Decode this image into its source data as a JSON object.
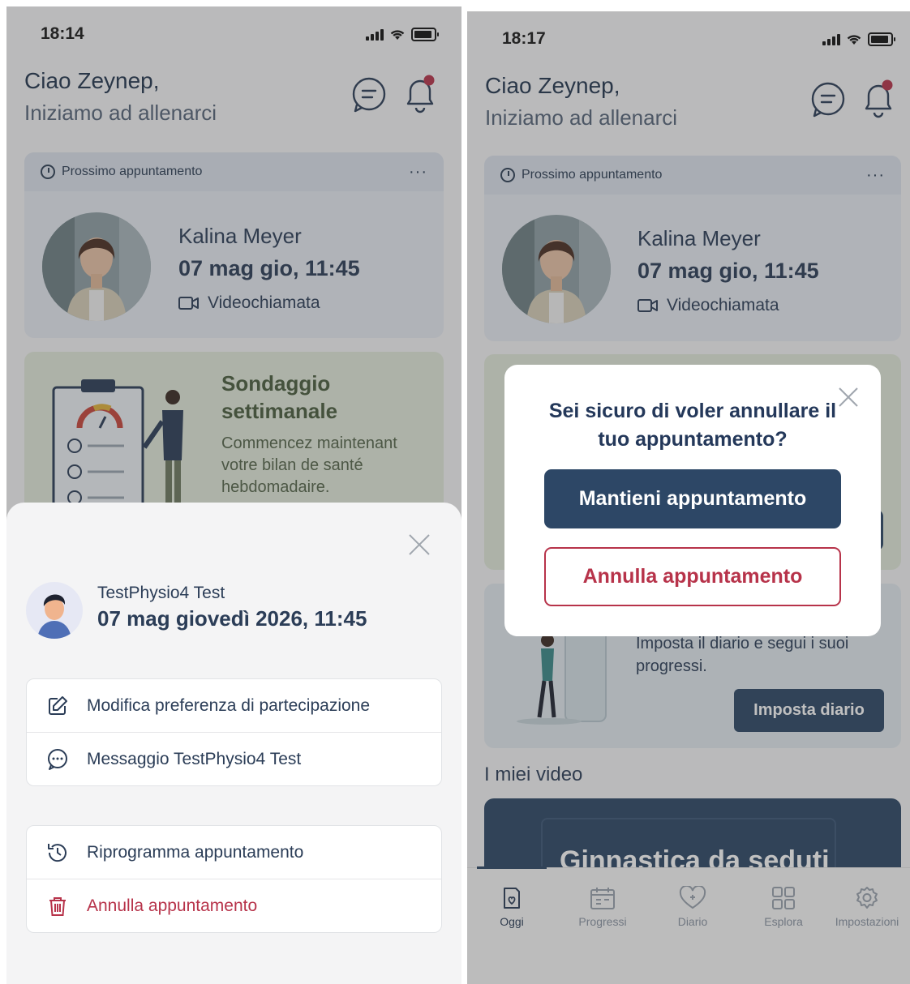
{
  "left": {
    "status_time": "18:14",
    "greeting": "Ciao Zeynep,",
    "subgreeting": "Iniziamo ad allenarci",
    "next_appointment": {
      "header": "Prossimo appuntamento",
      "more": "···",
      "name": "Kalina Meyer",
      "date": "07 mag gio, 11:45",
      "type": "Videochiamata"
    },
    "survey": {
      "title_line1": "Sondaggio",
      "title_line2": "settimanale",
      "desc_line1": "Commencez maintenant",
      "desc_line2": "votre bilan de santé",
      "desc_line3": "hebdomadaire."
    },
    "sheet": {
      "therapist": "TestPhysio4 Test",
      "datetime": "07 mag giovedì 2026, 11:45",
      "actions_group1": [
        {
          "label": "Modifica preferenza di partecipazione",
          "icon": "edit-icon"
        },
        {
          "label": "Messaggio TestPhysio4 Test",
          "icon": "chat-icon"
        }
      ],
      "actions_group2": [
        {
          "label": "Riprogramma appuntamento",
          "icon": "history-icon"
        },
        {
          "label": "Annulla appuntamento",
          "icon": "trash-icon"
        }
      ]
    }
  },
  "right": {
    "status_time": "18:17",
    "greeting": "Ciao Zeynep,",
    "subgreeting": "Iniziamo ad allenarci",
    "next_appointment": {
      "header": "Prossimo appuntamento",
      "more": "···",
      "name": "Kalina Meyer",
      "date": "07 mag gio, 11:45",
      "type": "Videochiamata"
    },
    "diary": {
      "desc_line1": "Imposta il diario e segui i suoi",
      "desc_line2": "progressi.",
      "button": "Imposta diario"
    },
    "videos": {
      "heading": "I miei video",
      "card_title": "Ginnastica da seduti"
    },
    "modal": {
      "question_line1": "Sei sicuro di voler annullare il",
      "question_line2": "tuo appuntamento?",
      "keep_button": "Mantieni appuntamento",
      "cancel_button": "Annulla appuntamento"
    },
    "tabs": [
      {
        "label": "Oggi",
        "icon": "today-icon",
        "active": true
      },
      {
        "label": "Progressi",
        "icon": "calendar-icon",
        "active": false
      },
      {
        "label": "Diario",
        "icon": "heart-plus-icon",
        "active": false
      },
      {
        "label": "Esplora",
        "icon": "grid-icon",
        "active": false
      },
      {
        "label": "Impostazioni",
        "icon": "settings-icon",
        "active": false
      }
    ]
  },
  "colors": {
    "primary": "#2d4766",
    "danger": "#b7334a",
    "survey_bg": "#e4ebdc",
    "appointment_bg": "#e8ecf3"
  }
}
